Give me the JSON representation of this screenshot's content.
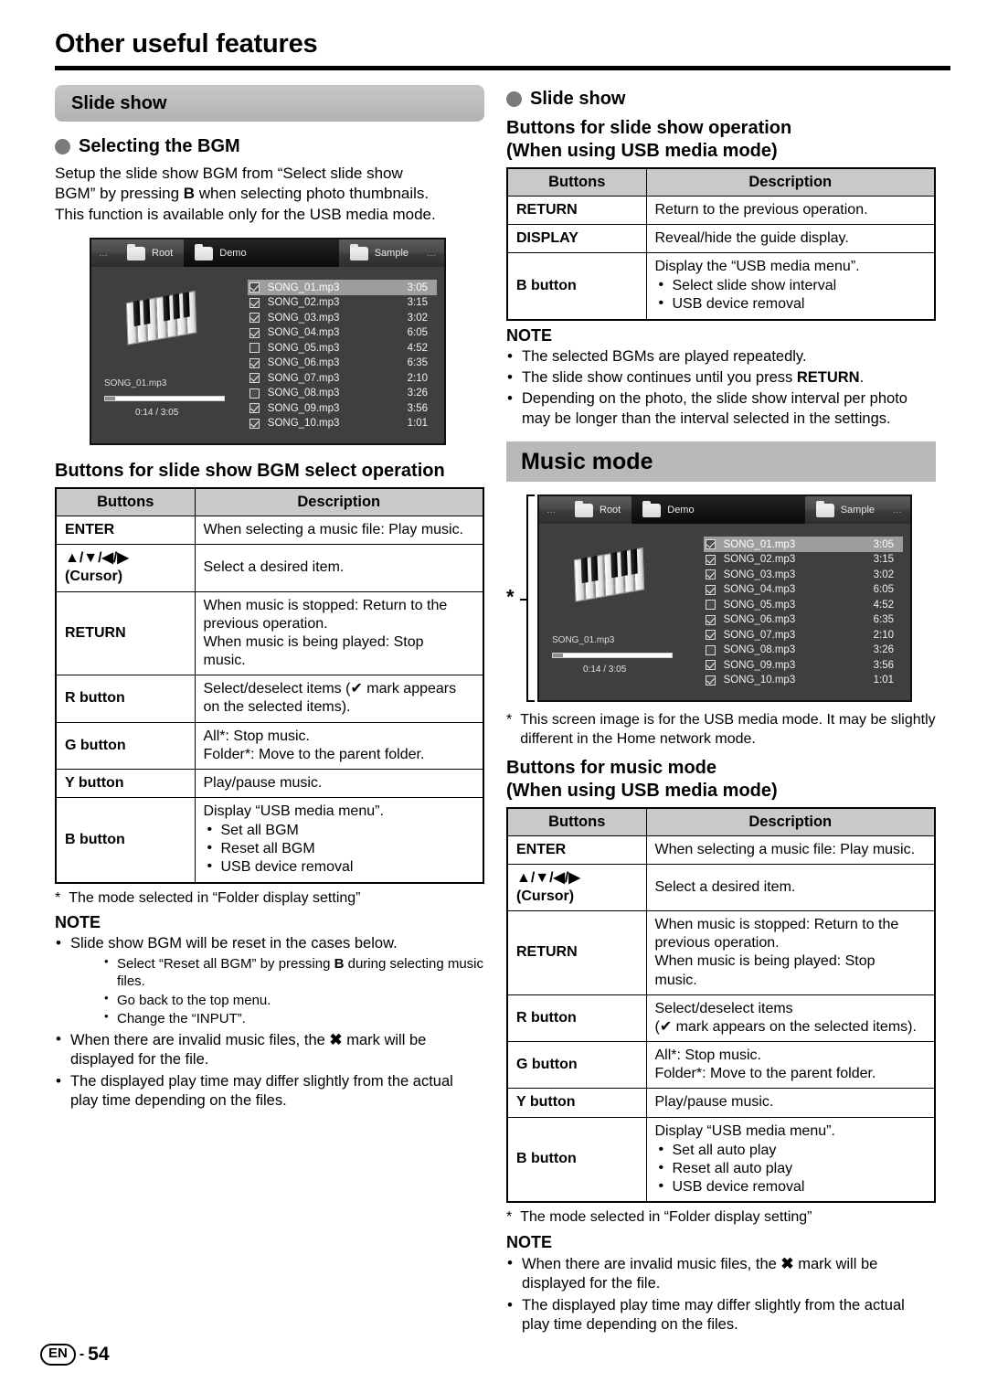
{
  "page": {
    "title": "Other useful features",
    "footer": {
      "lang": "EN",
      "dash": "-",
      "number": "54"
    }
  },
  "left": {
    "banner": "Slide show",
    "bullet_head": "Selecting the BGM",
    "intro_1": "Setup the slide show BGM from “Select slide show",
    "intro_2a": "BGM” by pressing ",
    "intro_2b": "B",
    "intro_2c": " when selecting photo thumbnails.",
    "intro_3": "This function is available only for the USB media mode.",
    "table_title": "Buttons for slide show BGM select operation",
    "table": {
      "headers": [
        "Buttons",
        "Description"
      ],
      "rows": [
        {
          "key": "ENTER",
          "desc": [
            "When selecting a music file: Play music."
          ]
        },
        {
          "key": "▲/▼/◀/▶",
          "key2": "(Cursor)",
          "desc": [
            "Select a desired item."
          ]
        },
        {
          "key": "RETURN",
          "desc": [
            "When music is stopped: Return to the",
            "previous operation.",
            "When music is being played: Stop",
            "music."
          ]
        },
        {
          "key": "R button",
          "desc": [
            "Select/deselect items (✔ mark appears",
            "on the selected items)."
          ]
        },
        {
          "key": "G button",
          "desc": [
            "All*: Stop music.",
            "Folder*: Move to the parent folder."
          ]
        },
        {
          "key": "Y button",
          "desc": [
            "Play/pause music."
          ]
        },
        {
          "key": "B button",
          "desc": [
            "Display “USB media menu”."
          ],
          "bullets": [
            "Set all BGM",
            "Reset all BGM",
            "USB device removal"
          ]
        }
      ]
    },
    "footnote_star": "*",
    "footnote": "The mode selected in “Folder display setting”",
    "note_title": "NOTE",
    "notes": [
      {
        "text": "Slide show BGM will be reset in the cases below.",
        "sub": [
          "Select “Reset all BGM” by pressing B during selecting music files.",
          "Go back to the top menu.",
          "Change the “INPUT”."
        ]
      },
      {
        "text": "When there are invalid music files, the ✖ mark will be displayed for the file."
      },
      {
        "text": "The displayed play time may differ slightly from the actual play time depending on the files."
      }
    ]
  },
  "right": {
    "bullet_head": "Slide show",
    "sub_head_1": "Buttons for slide show operation",
    "sub_head_2": "(When using USB media mode)",
    "table": {
      "headers": [
        "Buttons",
        "Description"
      ],
      "rows": [
        {
          "key": "RETURN",
          "desc": [
            "Return to the previous operation."
          ]
        },
        {
          "key": "DISPLAY",
          "desc": [
            "Reveal/hide the guide display."
          ]
        },
        {
          "key": "B button",
          "desc": [
            "Display the “USB media menu”."
          ],
          "bullets": [
            "Select slide show interval",
            "USB device removal"
          ]
        }
      ]
    },
    "note_title": "NOTE",
    "notes": [
      "The selected BGMs are played repeatedly.",
      "The slide show continues until you press RETURN.",
      "Depending on the photo, the slide show interval per photo may be longer than the interval selected in the settings."
    ],
    "banner": "Music mode",
    "screen_footnote_star": "*",
    "screen_footnote": "This screen image is for the USB media mode. It may be slightly different in the Home network mode.",
    "sub_head_3": "Buttons for music mode",
    "sub_head_4": "(When using USB media mode)",
    "table2": {
      "headers": [
        "Buttons",
        "Description"
      ],
      "rows": [
        {
          "key": "ENTER",
          "desc": [
            "When selecting a music file: Play music."
          ]
        },
        {
          "key": "▲/▼/◀/▶",
          "key2": "(Cursor)",
          "desc": [
            "Select a desired item."
          ]
        },
        {
          "key": "RETURN",
          "desc": [
            "When music is stopped: Return to the",
            "previous operation.",
            "When music is being played: Stop",
            "music."
          ]
        },
        {
          "key": "R button",
          "desc": [
            "Select/deselect items",
            "(✔ mark appears on the selected items)."
          ]
        },
        {
          "key": "G button",
          "desc": [
            "All*: Stop music.",
            "Folder*: Move to the parent folder."
          ]
        },
        {
          "key": "Y button",
          "desc": [
            "Play/pause music."
          ]
        },
        {
          "key": "B button",
          "desc": [
            "Display “USB media menu”."
          ],
          "bullets": [
            "Set all auto play",
            "Reset all auto play",
            "USB device removal"
          ]
        }
      ]
    },
    "footnote_star": "*",
    "footnote": "The mode selected in “Folder display setting”",
    "note_title_2": "NOTE",
    "notes2": [
      "When there are invalid music files, the ✖ mark will be displayed for the file.",
      "The displayed play time may differ slightly from the actual play time depending on the files."
    ]
  },
  "tv_screen": {
    "tabs": [
      {
        "label": "…",
        "type": "ellipsis"
      },
      {
        "label": "Root",
        "active": false
      },
      {
        "label": "Demo",
        "active": true
      },
      {
        "label": "Sample",
        "active": false
      },
      {
        "label": "…",
        "type": "ellipsis"
      }
    ],
    "now_playing": {
      "name": "SONG_01.mp3",
      "time": "0:14 / 3:05"
    },
    "songs": [
      {
        "name": "SONG_01.mp3",
        "time": "3:05",
        "checked": true,
        "selected": true
      },
      {
        "name": "SONG_02.mp3",
        "time": "3:15",
        "checked": true,
        "selected": false
      },
      {
        "name": "SONG_03.mp3",
        "time": "3:02",
        "checked": true,
        "selected": false
      },
      {
        "name": "SONG_04.mp3",
        "time": "6:05",
        "checked": true,
        "selected": false
      },
      {
        "name": "SONG_05.mp3",
        "time": "4:52",
        "checked": false,
        "selected": false
      },
      {
        "name": "SONG_06.mp3",
        "time": "6:35",
        "checked": true,
        "selected": false
      },
      {
        "name": "SONG_07.mp3",
        "time": "2:10",
        "checked": true,
        "selected": false
      },
      {
        "name": "SONG_08.mp3",
        "time": "3:26",
        "checked": false,
        "selected": false
      },
      {
        "name": "SONG_09.mp3",
        "time": "3:56",
        "checked": true,
        "selected": false
      },
      {
        "name": "SONG_10.mp3",
        "time": "1:01",
        "checked": true,
        "selected": false
      }
    ]
  },
  "colors": {
    "banner_grey": "#b9b9b9",
    "table_header_grey": "#c9c9c9",
    "bullet_dot": "#7b7b7b",
    "screen_bg": "#3f3f3f",
    "screen_selected": "#9d9d9d"
  }
}
